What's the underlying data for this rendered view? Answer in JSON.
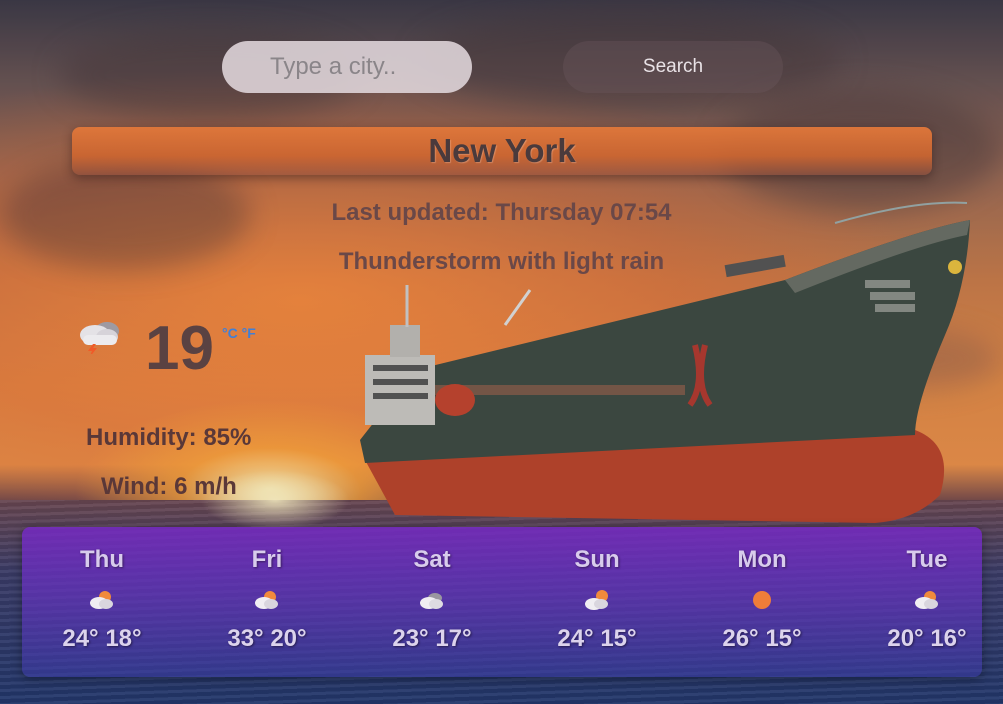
{
  "search": {
    "placeholder": "Type a city..",
    "button_label": "Search"
  },
  "city": "New York",
  "last_updated": "Last updated: Thursday 07:54",
  "description": "Thunderstorm with light rain",
  "current": {
    "icon": "thunderstorm-rain-icon",
    "temperature": "19",
    "unit_celsius": "°C",
    "unit_fahrenheit": "°F",
    "humidity": "Humidity: 85%",
    "wind": "Wind: 6 m/h"
  },
  "forecast": [
    {
      "day": "Thu",
      "icon": "partly-cloudy-sun-icon",
      "temps": "24° 18°"
    },
    {
      "day": "Fri",
      "icon": "partly-cloudy-sun-icon",
      "temps": "33° 20°"
    },
    {
      "day": "Sat",
      "icon": "cloudy-icon",
      "temps": "23° 17°"
    },
    {
      "day": "Sun",
      "icon": "partly-cloudy-sun-icon",
      "temps": "24° 15°"
    },
    {
      "day": "Mon",
      "icon": "sun-icon",
      "temps": "26° 15°"
    },
    {
      "day": "Tue",
      "icon": "partly-cloudy-sun-icon",
      "temps": "20° 16°"
    }
  ],
  "colors": {
    "unit_link": "#3f7fd8",
    "banner": "#e2783a",
    "forecast_panel": "#7628c8"
  }
}
